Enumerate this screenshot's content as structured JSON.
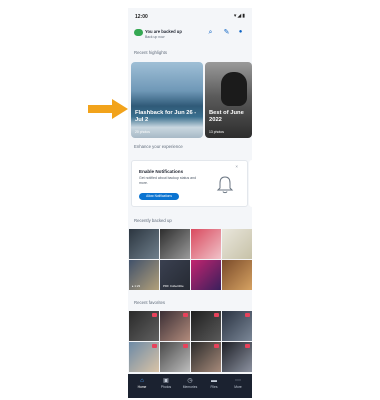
{
  "status_bar": {
    "time": "12:00",
    "icons": "▾◢▮"
  },
  "app_bar": {
    "title": "You are backed up",
    "subtitle": "Back up now",
    "actions": [
      {
        "icon": "search-icon",
        "glyph": "⌕"
      },
      {
        "icon": "notifications-icon",
        "glyph": "✎"
      },
      {
        "icon": "account-icon",
        "glyph": "●"
      }
    ]
  },
  "sections": {
    "highlights": "Recent highlights",
    "enhance": "Enhance your experience",
    "backed_up": "Recently backed up",
    "favorites": "Recent favorites"
  },
  "highlights": [
    {
      "title": "Flashback for Jun 26 - Jul 2",
      "count": "20 photos"
    },
    {
      "title": "Best of June 2022",
      "count": "13 photos"
    }
  ],
  "notification_card": {
    "title": "Enable Notifications",
    "body": "Get notified about backup status and more.",
    "button": "Allow Notifications",
    "close": "×"
  },
  "backed_up_tiles": [
    {
      "caption": "",
      "colors": [
        "#2c3640",
        "#6f7f8c"
      ]
    },
    {
      "caption": "",
      "colors": [
        "#2e2e2e",
        "#9a9a9a"
      ]
    },
    {
      "caption": "",
      "colors": [
        "#d94a5f",
        "#f0c2c8"
      ]
    },
    {
      "caption": "",
      "colors": [
        "#e9e6dc",
        "#c7c2a8"
      ]
    },
    {
      "caption": "▸ 1:23",
      "colors": [
        "#41516a",
        "#b2a07a"
      ]
    },
    {
      "caption": "PDF Collectible",
      "colors": [
        "#3a4050",
        "#262a33"
      ]
    },
    {
      "caption": "",
      "colors": [
        "#c2246f",
        "#3a1f5c"
      ]
    },
    {
      "caption": "",
      "colors": [
        "#7a4b2a",
        "#d6a262"
      ]
    }
  ],
  "favorite_tiles": [
    {
      "colors": [
        "#2a2a2a",
        "#606060"
      ]
    },
    {
      "colors": [
        "#3b2f35",
        "#b28b7c"
      ]
    },
    {
      "colors": [
        "#1f1f1f",
        "#5a5a5a"
      ]
    },
    {
      "colors": [
        "#2a3342",
        "#7b8797"
      ]
    },
    {
      "colors": [
        "#6d8aa6",
        "#d9c3a6"
      ]
    },
    {
      "colors": [
        "#4a4a4a",
        "#bdbdbd"
      ]
    },
    {
      "colors": [
        "#2b2b2b",
        "#a68a7a"
      ]
    },
    {
      "colors": [
        "#1d1f26",
        "#8c92a0"
      ]
    }
  ],
  "bottom_nav": [
    {
      "label": "Home",
      "icon": "home-icon",
      "glyph": "⌂",
      "active": true
    },
    {
      "label": "Photos",
      "icon": "photos-icon",
      "glyph": "▣",
      "active": false
    },
    {
      "label": "Memories",
      "icon": "memories-icon",
      "glyph": "◷",
      "active": false
    },
    {
      "label": "Files",
      "icon": "files-icon",
      "glyph": "▬",
      "active": false
    },
    {
      "label": "More",
      "icon": "more-icon",
      "glyph": "⋯",
      "active": false
    }
  ],
  "accent_arrow_color": "#f2a31b"
}
